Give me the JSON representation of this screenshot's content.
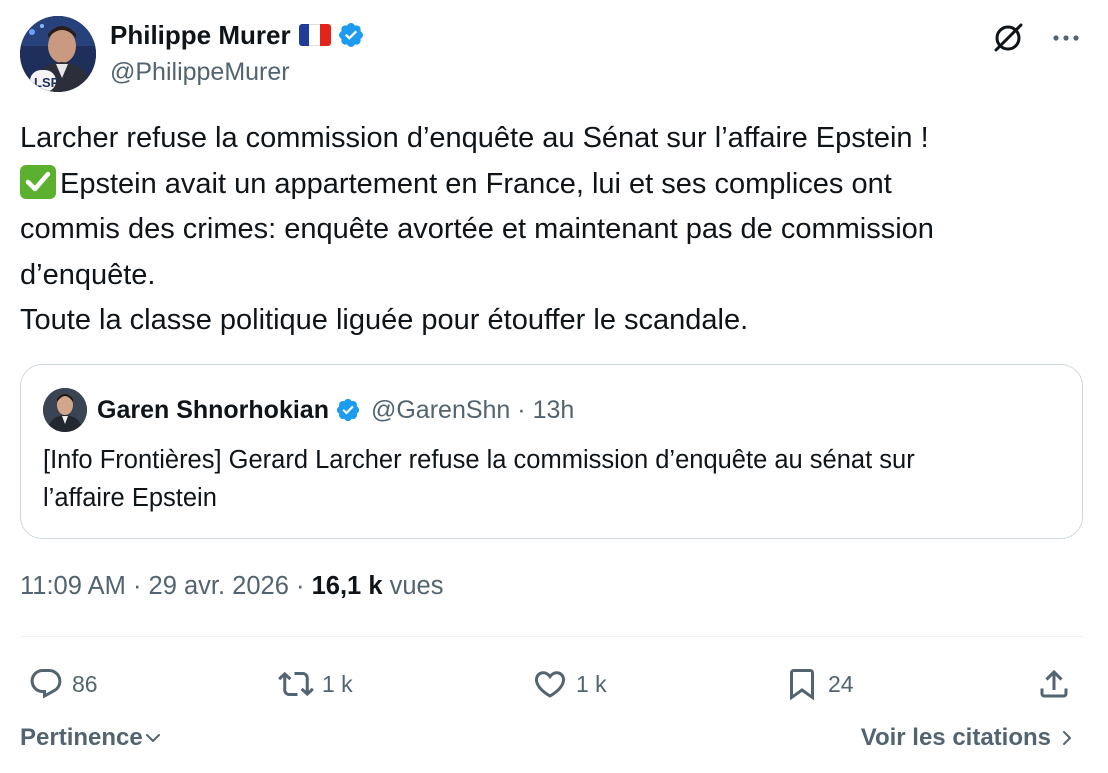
{
  "author": {
    "name": "Philippe Murer",
    "handle": "@PhilippeMurer"
  },
  "tweet": {
    "lines": [
      "Larcher refuse la commission d’enquête au Sénat sur l’affaire Epstein !",
      "Epstein avait un appartement en France, lui et ses complices ont",
      "commis des crimes: enquête avortée et maintenant pas de commission",
      "d’enquête.",
      "Toute la classe politique liguée pour étouffer le scandale."
    ],
    "check_emoji": "check-mark-button-emoji"
  },
  "quote": {
    "name": "Garen Shnorhokian",
    "handle": "@GarenShn",
    "separator": "·",
    "time": "13h",
    "text_lines": [
      "[Info Frontières] Gerard Larcher refuse la commission d’enquête au sénat sur",
      "l’affaire Epstein"
    ]
  },
  "meta": {
    "time": "11:09 AM",
    "separator": "·",
    "date": "29 avr. 2026",
    "views_count": "16,1 k",
    "views_label": "vues"
  },
  "actions": {
    "replies": "86",
    "reposts": "1 k",
    "likes": "1 k",
    "bookmarks": "24"
  },
  "footer": {
    "sort_label": "Pertinence",
    "quotes_label": "Voir les citations"
  },
  "colors": {
    "text": "#0f1419",
    "secondary": "#536471",
    "verified": "#1d9bf0",
    "border": "#cfd9de",
    "flag_blue": "#1f3d9a",
    "flag_white": "#ffffff",
    "flag_red": "#e1251b"
  },
  "icons": [
    "verified-badge-icon",
    "grok-icon",
    "more-icon",
    "reply-icon",
    "repost-icon",
    "like-icon",
    "bookmark-icon",
    "share-icon",
    "chevron-down-icon",
    "chevron-right-icon"
  ]
}
